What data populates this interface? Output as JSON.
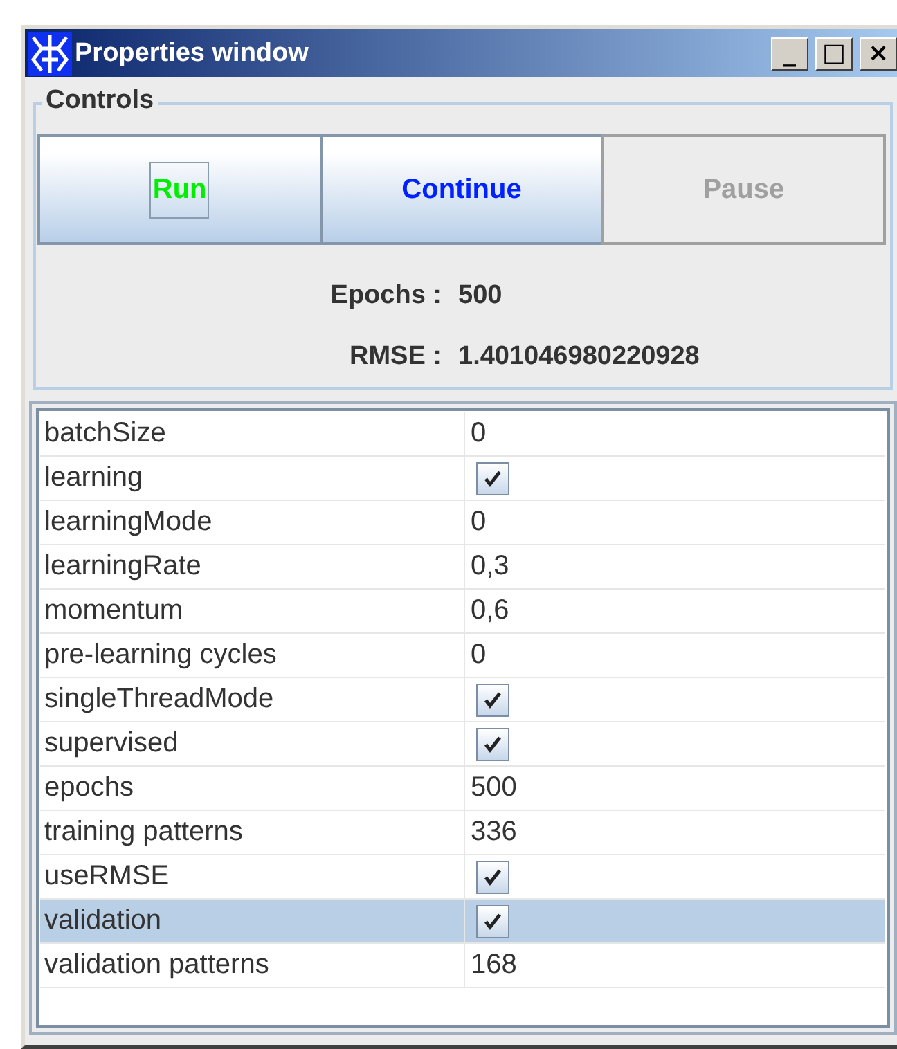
{
  "window": {
    "title": "Properties window",
    "controls": [
      "_",
      "□",
      "×"
    ]
  },
  "controls": {
    "title": "Controls",
    "buttons": [
      {
        "label": "Run",
        "color": "#00ee00",
        "disabled": false,
        "focused": true
      },
      {
        "label": "Continue",
        "color": "#0022ff",
        "disabled": false,
        "focused": false
      },
      {
        "label": "Pause",
        "color": "#a0a0a0",
        "disabled": true,
        "focused": false
      }
    ],
    "readouts": [
      {
        "label": "Epochs :",
        "value": "500"
      },
      {
        "label": "RMSE :",
        "value": "1.401046980220928"
      }
    ]
  },
  "properties": [
    {
      "name": "batchSize",
      "kind": "text",
      "value": "0",
      "selected": false
    },
    {
      "name": "learning",
      "kind": "checkbox",
      "checked": true,
      "selected": false
    },
    {
      "name": "learningMode",
      "kind": "text",
      "value": "0",
      "selected": false
    },
    {
      "name": "learningRate",
      "kind": "text",
      "value": "0,3",
      "selected": false
    },
    {
      "name": "momentum",
      "kind": "text",
      "value": "0,6",
      "selected": false
    },
    {
      "name": "pre-learning cycles",
      "kind": "text",
      "value": "0",
      "selected": false
    },
    {
      "name": "singleThreadMode",
      "kind": "checkbox",
      "checked": true,
      "selected": false
    },
    {
      "name": "supervised",
      "kind": "checkbox",
      "checked": true,
      "selected": false
    },
    {
      "name": "epochs",
      "kind": "text",
      "value": "500",
      "selected": false
    },
    {
      "name": "training patterns",
      "kind": "text",
      "value": "336",
      "selected": false
    },
    {
      "name": "useRMSE",
      "kind": "checkbox",
      "checked": true,
      "selected": false
    },
    {
      "name": "validation",
      "kind": "checkbox",
      "checked": true,
      "selected": true
    },
    {
      "name": "validation patterns",
      "kind": "text",
      "value": "168",
      "selected": false
    }
  ]
}
